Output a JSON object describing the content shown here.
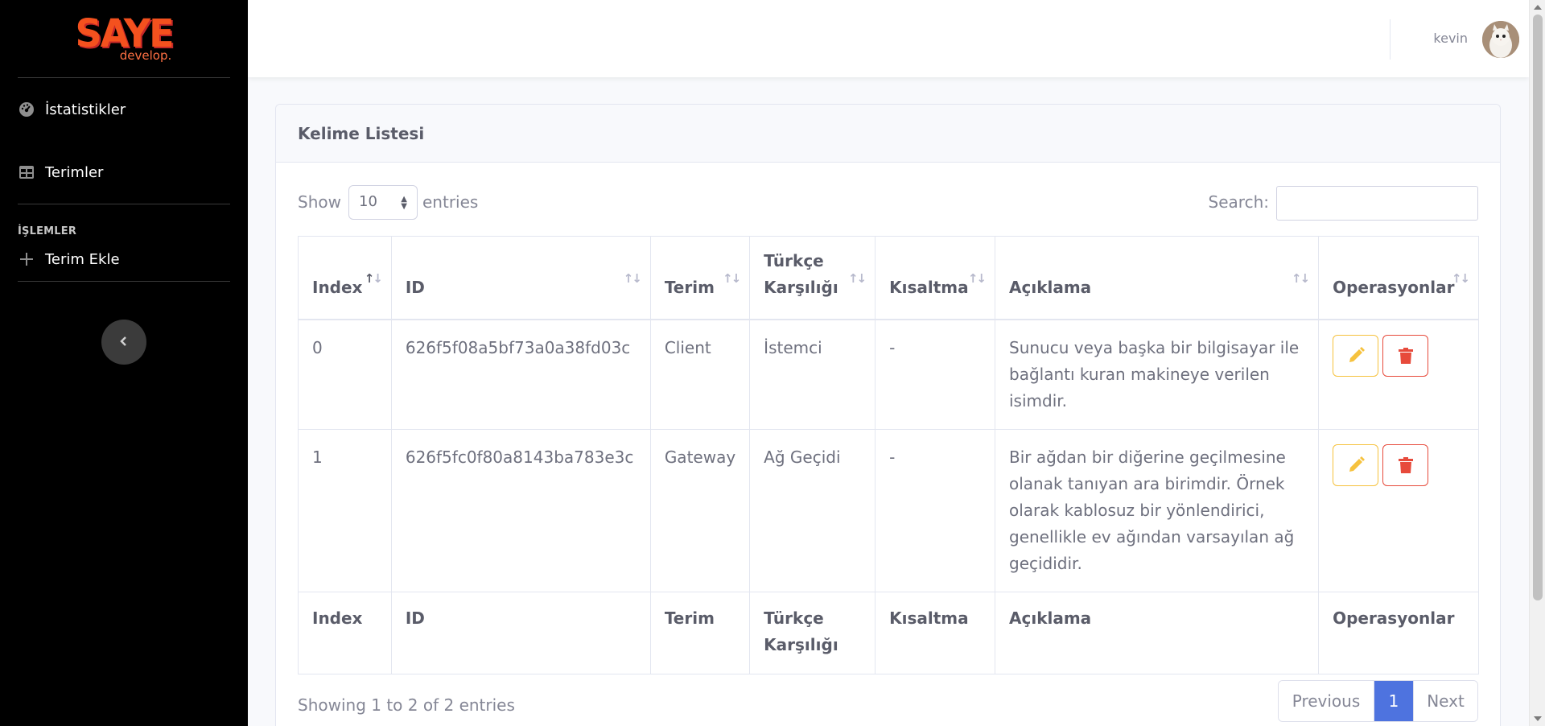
{
  "brand": {
    "main": "SAYE",
    "sub": "develop."
  },
  "sidebar": {
    "items": [
      {
        "label": "İstatistikler",
        "icon": "dashboard-icon"
      },
      {
        "label": "Terimler",
        "icon": "table-icon"
      }
    ],
    "heading": "İŞLEMLER",
    "actions": [
      {
        "label": "Terim Ekle",
        "icon": "plus-icon"
      }
    ]
  },
  "topbar": {
    "user_name": "kevin"
  },
  "card": {
    "title": "Kelime Listesi"
  },
  "controls": {
    "show_label": "Show",
    "page_size": "10",
    "entries_label": "entries",
    "search_label": "Search:",
    "search_value": ""
  },
  "table": {
    "headers": [
      "Index",
      "ID",
      "Terim",
      "Türkçe Karşılığı",
      "Kısaltma",
      "Açıklama",
      "Operasyonlar"
    ],
    "rows": [
      {
        "index": "0",
        "id": "626f5f08a5bf73a0a38fd03c",
        "term": "Client",
        "turkish": "İstemci",
        "abbr": "-",
        "description": "Sunucu veya başka bir bilgisayar ile bağlantı kuran makineye verilen isimdir."
      },
      {
        "index": "1",
        "id": "626f5fc0f80a8143ba783e3c",
        "term": "Gateway",
        "turkish": "Ağ Geçidi",
        "abbr": "-",
        "description": "Bir ağdan bir diğerine geçilmesine olanak tanıyan ara birimdir. Örnek olarak kablosuz bir yönlendirici, genellikle ev ağından varsayılan ağ geçididir."
      }
    ]
  },
  "footer": {
    "info": "Showing 1 to 2 of 2 entries",
    "previous": "Previous",
    "current_page": "1",
    "next": "Next"
  },
  "colors": {
    "sidebar_bg": "#000000",
    "primary": "#4e73df",
    "warning": "#f6c23e",
    "danger": "#e74a3b"
  }
}
